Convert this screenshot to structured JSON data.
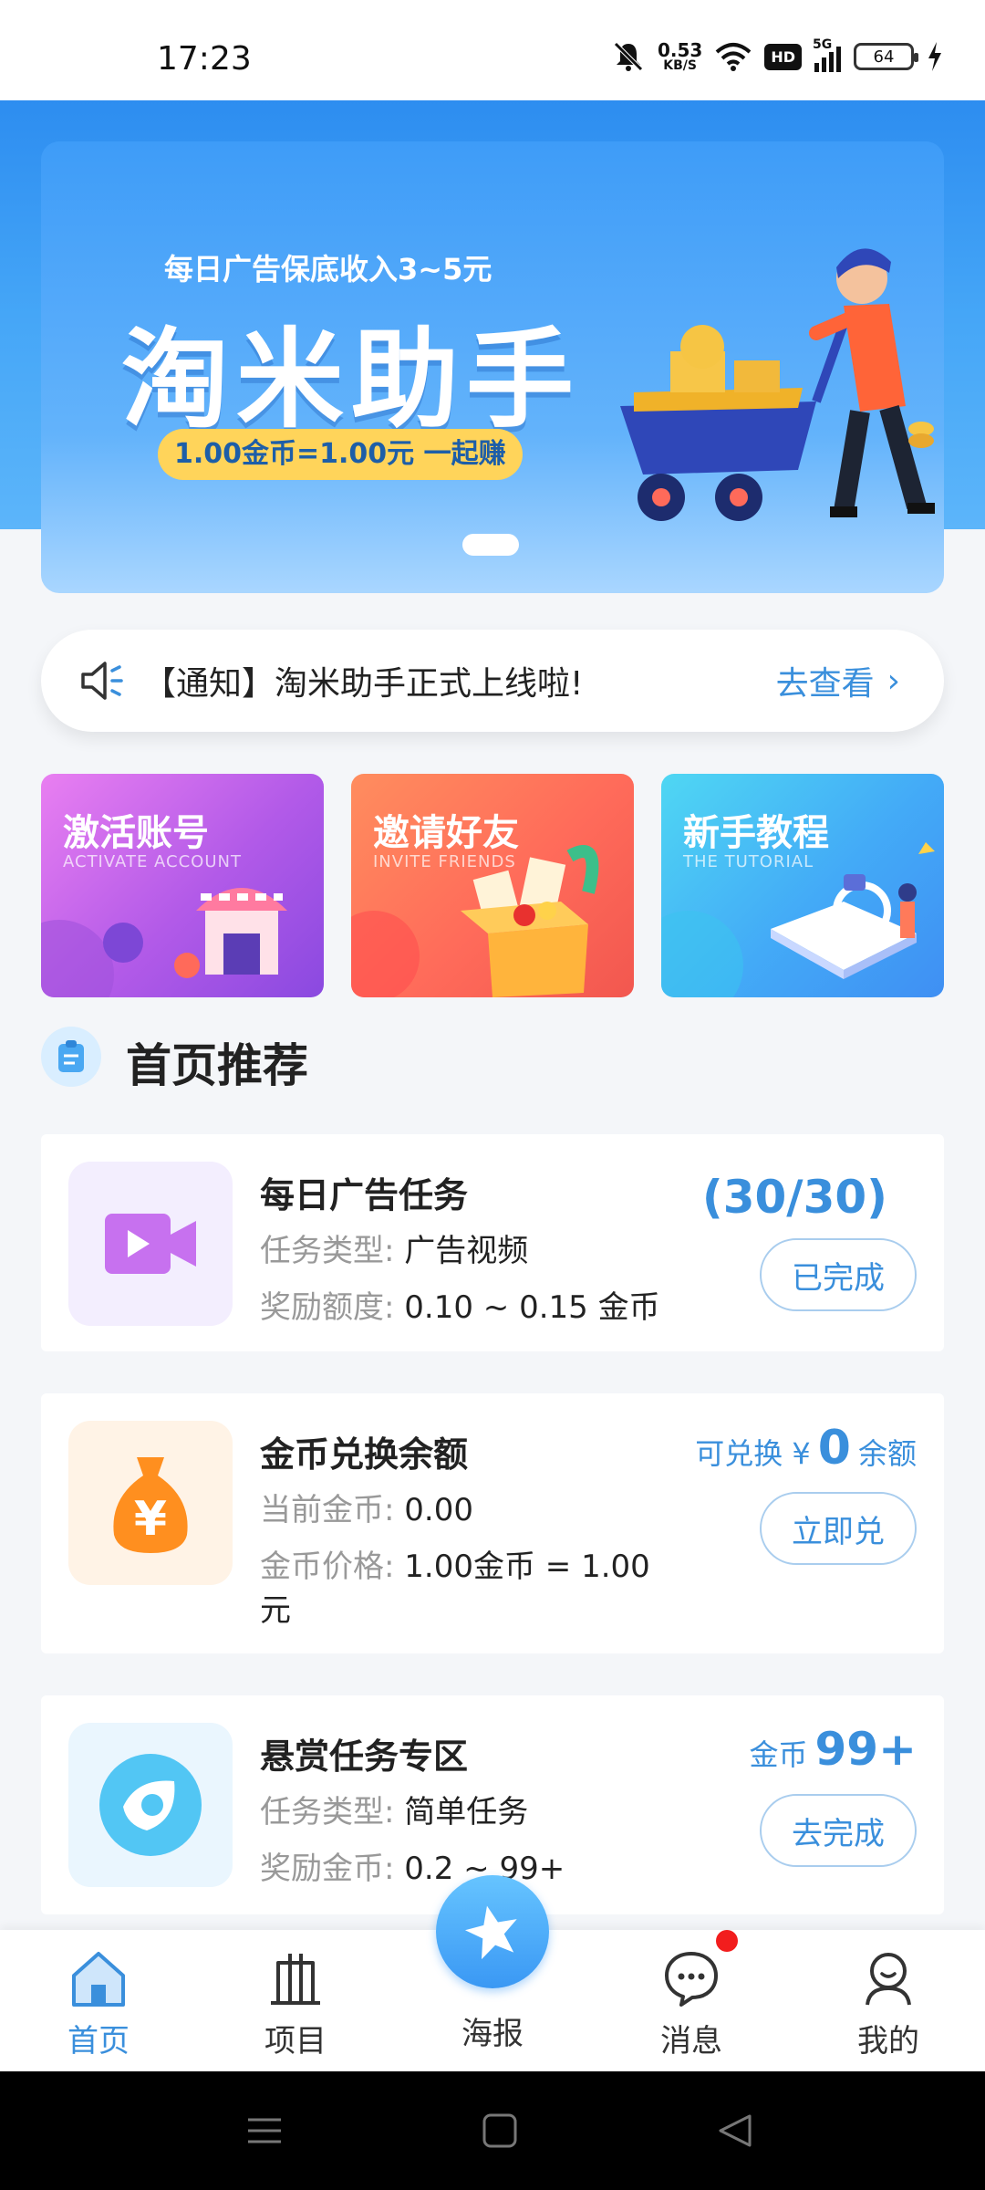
{
  "status_bar": {
    "time": "17:23",
    "net_speed": "0.53",
    "net_unit": "KB/S",
    "hd": "HD",
    "network": "5G",
    "battery": "64"
  },
  "banner": {
    "subtitle": "每日广告保底收入3~5元",
    "title": "淘米助手",
    "pill": "1.00金币=1.00元 一起赚"
  },
  "notice": {
    "text": "【通知】淘米助手正式上线啦!",
    "link": "去查看"
  },
  "features": [
    {
      "title": "激活账号",
      "en": "ACTIVATE ACCOUNT"
    },
    {
      "title": "邀请好友",
      "en": "INVITE FRIENDS"
    },
    {
      "title": "新手教程",
      "en": "THE TUTORIAL"
    }
  ],
  "section": {
    "title": "首页推荐"
  },
  "cards": [
    {
      "name": "每日广告任务",
      "row1_label": "任务类型:",
      "row1_value": "广告视频",
      "row2_label": "奖励额度:",
      "row2_value": "0.10 ~ 0.15 金币",
      "progress": "(30/30)",
      "button": "已完成"
    },
    {
      "name": "金币兑换余额",
      "row1_label": "当前金币:",
      "row1_value": "0.00",
      "row2_label": "金币价格:",
      "row2_value": "1.00金币 = 1.00",
      "row2_wrap": "元",
      "exch_prefix": "可兑换 ¥",
      "exch_value": "0",
      "exch_suffix": "余额",
      "button": "立即兑"
    },
    {
      "name": "悬赏任务专区",
      "row1_label": "任务类型:",
      "row1_value": "简单任务",
      "row2_label": "奖励金币:",
      "row2_value": "0.2 ~ 99+",
      "coin_prefix": "金币",
      "coin_value": "99+",
      "button": "去完成"
    }
  ],
  "tabs": [
    {
      "label": "首页",
      "icon": "home-icon",
      "active": true
    },
    {
      "label": "项目",
      "icon": "building-icon",
      "active": false
    },
    {
      "label": "海报",
      "icon": "star-icon",
      "active": false
    },
    {
      "label": "消息",
      "icon": "chat-icon",
      "active": false
    },
    {
      "label": "我的",
      "icon": "user-icon",
      "active": false
    }
  ],
  "colors": {
    "accent": "#3a8fdc",
    "badge": "#f21d1d",
    "banner_pill": "#ffd45a"
  }
}
